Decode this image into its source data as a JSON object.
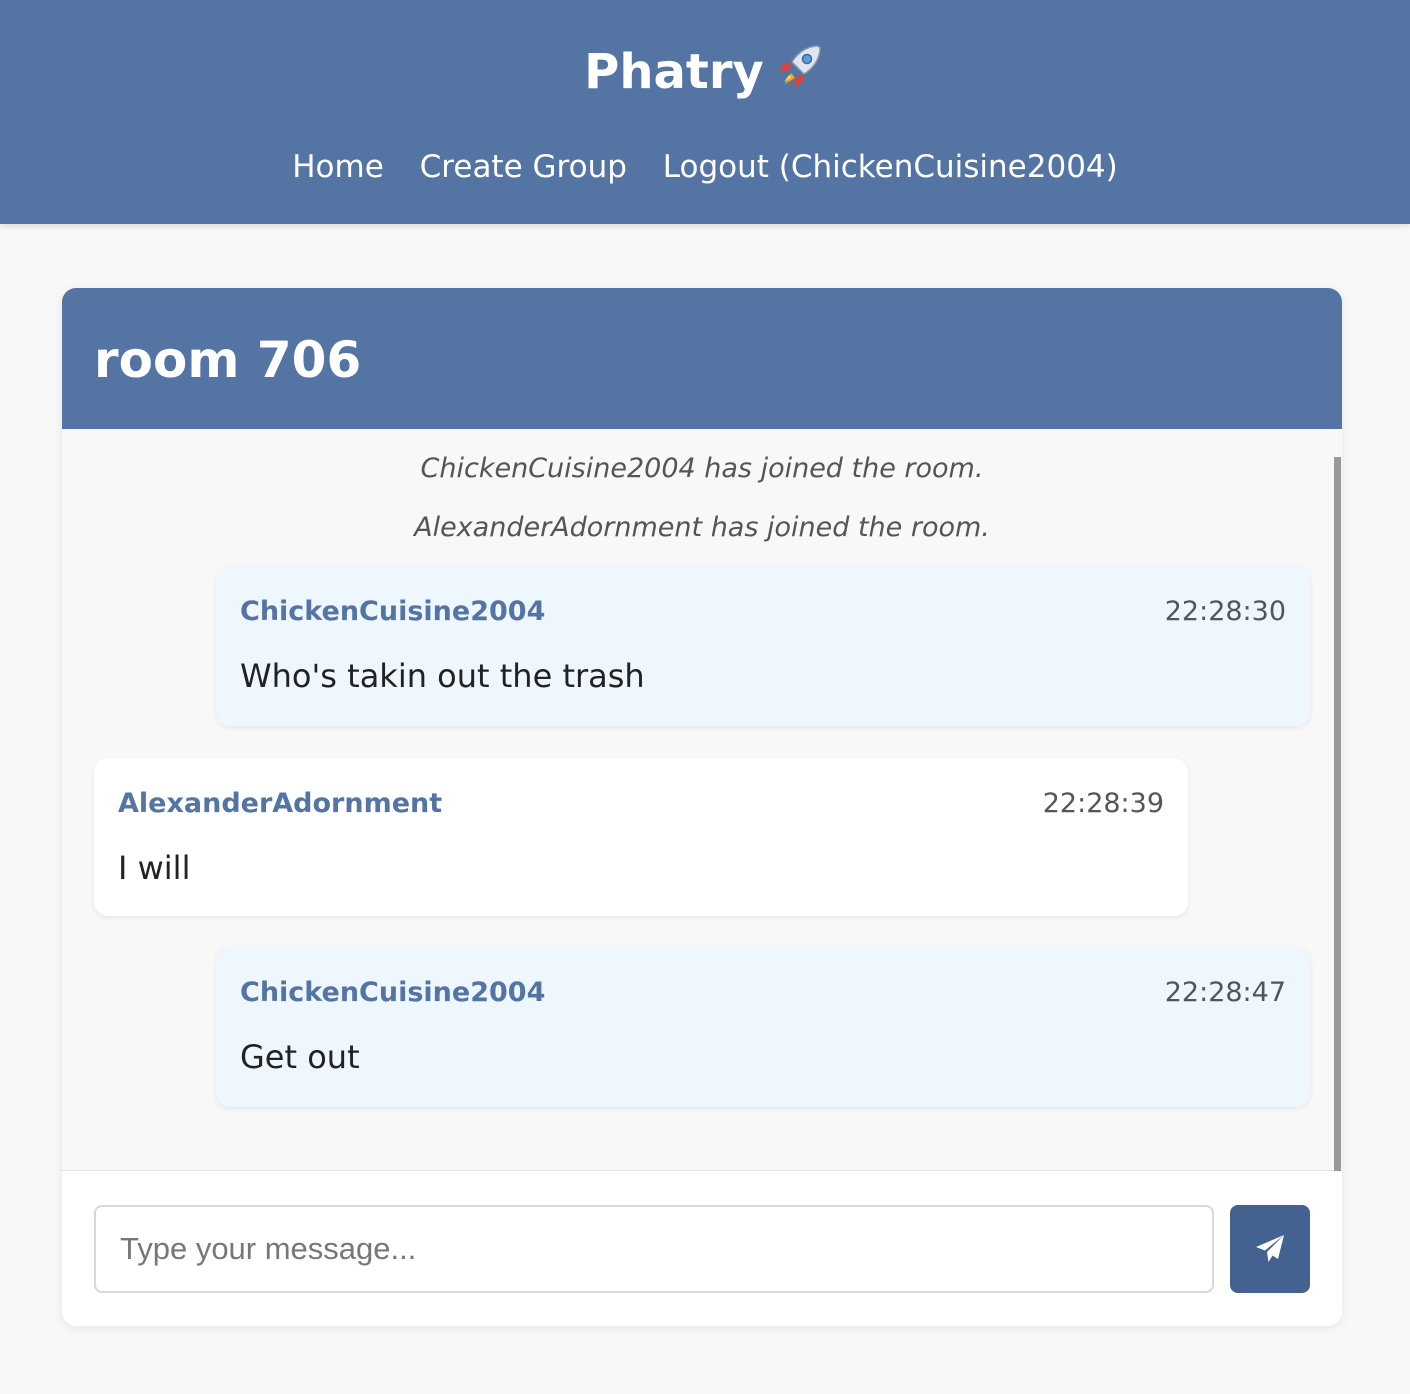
{
  "header": {
    "brand": "Phatry",
    "brand_icon": "rocket-icon",
    "nav": {
      "home": "Home",
      "create_group": "Create Group",
      "logout": "Logout (ChickenCuisine2004)"
    }
  },
  "room": {
    "title": "room 706",
    "system_messages": [
      "ChickenCuisine2004 has joined the room.",
      "AlexanderAdornment has joined the room."
    ],
    "messages": [
      {
        "user": "ChickenCuisine2004",
        "time": "22:28:30",
        "text": "Who's takin out the trash",
        "own": true
      },
      {
        "user": "AlexanderAdornment",
        "time": "22:28:39",
        "text": "I will",
        "own": false
      },
      {
        "user": "ChickenCuisine2004",
        "time": "22:28:47",
        "text": "Get out",
        "own": true
      }
    ]
  },
  "composer": {
    "placeholder": "Type your message...",
    "value": "",
    "send_icon": "paper-plane-icon"
  },
  "colors": {
    "header": "#5474a4",
    "username": "#5474a4",
    "own_bubble": "#eef6fe",
    "other_bubble": "#ffffff",
    "send_button": "#44628f"
  }
}
